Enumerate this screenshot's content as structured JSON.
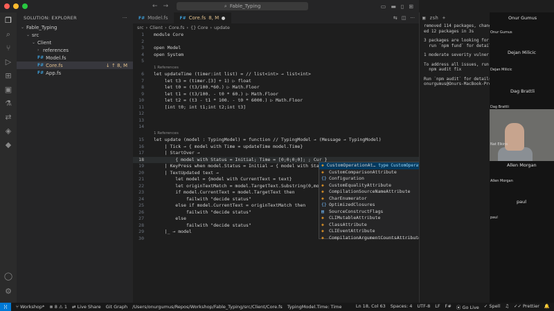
{
  "titlebar": {
    "search": "Fable_Typing"
  },
  "sidebar": {
    "header": "SOLUTION: EXPLORER",
    "items": [
      {
        "label": "Fable_Typing",
        "depth": 0
      },
      {
        "label": "src",
        "depth": 1
      },
      {
        "label": "Client",
        "depth": 2
      },
      {
        "label": "references",
        "depth": 3
      },
      {
        "label": "Model.fs",
        "depth": 3
      },
      {
        "label": "Core.fs",
        "depth": 3,
        "status": "↓ ↑ 8, M"
      },
      {
        "label": "App.fs",
        "depth": 3
      }
    ]
  },
  "tabs": [
    {
      "label": "Model.fs"
    },
    {
      "label": "Core.fs",
      "suffix": "8, M"
    }
  ],
  "breadcrumb": [
    "src",
    "Client",
    "Core.fs",
    "{} Core",
    "update"
  ],
  "editor": {
    "ref_lens_1": "1 References",
    "ref_lens_2": "1 References",
    "lines": {
      "l1": "module Core",
      "l2": "",
      "l3": "open Model",
      "l4": "open System",
      "l5": "",
      "l6": "let updateTime (timer:int list) = // list<int> → list<int>",
      "l7": "    let t3 = (timer.[3] + 1) ▷ float",
      "l8": "    let t0 = (t3/100.*60.) ▷ Math.Floor",
      "l9": "    let t1 = (t3/100. - t0 * 60.) ▷ Math.Floor",
      "l10": "    let t2 = (t3 - t1 * 100. - t0 * 6000.) ▷ Math.Floor",
      "l11": "    [int t0; int t1;int t2;int t3]",
      "l12": "",
      "l13": "",
      "l14": "",
      "l15": "let update (model : TypingModel) = function // TypingModel → (Message → TypingModel)",
      "l16": "    | Tick → { model with Time = updateTime model.Time}",
      "l17": "    | StartOver →",
      "l18": "        { model with Status = Initial; Time = [0;0;0;0]; ; Cur }",
      "l19": "    | KeyPress when model.Status = Initial → { model with Sta",
      "l20": "    | TextUpdated text →",
      "l21": "        let model = {model with CurrentText = text}",
      "l22": "        let originTextMatch = model.TargetText.Substring(0,mod",
      "l23": "        if model.CurrentText = model.TargetText then",
      "l24": "            failwith \"decide status\"",
      "l25": "        else if model.CurrentText = originTextMatch then",
      "l26": "            failwith \"decide status\"",
      "l27": "        else",
      "l28": "            failwith \"decide status\"",
      "l29": "    |_ → model",
      "l30": ""
    }
  },
  "suggest": {
    "items": [
      "CustomOperationAt…",
      "CustomComparisonAttribute",
      "Configuration",
      "CustomEqualityAttribute",
      "CompilationSourceNameAttribute",
      "CharEnumerator",
      "OptimizedClosures",
      "SourceConstructFlags",
      "CLIMutableAttribute",
      "ClassAttribute",
      "CLIEventAttribute",
      "CompilationArgumentCountsAttribute"
    ],
    "selected_detail": "type CustomOperationAttribute = in…"
  },
  "terminal": {
    "tab": "zsh",
    "lines": [
      "removed 114 packages, chang",
      "ed 12 packages in 3s",
      "",
      "3 packages are looking for",
      "  run `npm fund` for detail",
      "",
      "1 moderate severity vulner",
      "",
      "To address all issues, run:",
      "  npm audit fix",
      "",
      "Run `npm audit` for details",
      "onurgumus@Onurs-MacBook-Pro",
      "onurgumus@Onurs-MacBook-Pro"
    ]
  },
  "participants": {
    "p1": "Onur Gumus",
    "p1s": "Onur Gumus",
    "p2": "Dejan Milicic",
    "p2s": "Dejan Milicic",
    "p3": "Dag Brattli",
    "p3s": "Dag Brattli",
    "p4s": "Nat Elkins",
    "p5": "Allen Morgan",
    "p5s": "Allen Morgan",
    "p6": "paul",
    "p6s": "paul"
  },
  "statusbar": {
    "branch": "Workshop*",
    "problems": "⊗ 8 ⚠ 1",
    "live_share": "Live Share",
    "git_graph": "Git Graph",
    "path": "/Users/onurgumus/Repos/Workshop/Fable_Typing/src/Client/Core.fs",
    "type_info": "TypingModel.Time: Time",
    "position": "Ln 18, Col 63",
    "spaces": "Spaces: 4",
    "encoding": "UTF-8",
    "eol": "LF",
    "lang": "F#",
    "golive": "Go Live",
    "spell": "Spell",
    "prettier": "Prettier"
  }
}
